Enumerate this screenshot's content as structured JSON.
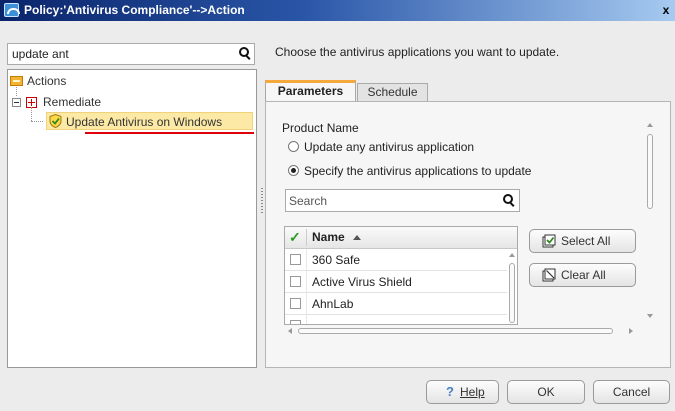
{
  "window": {
    "title": "Policy:'Antivirus Compliance'-->Action",
    "close_glyph": "x"
  },
  "left": {
    "search_value": "update ant",
    "tree": {
      "actions_label": "Actions",
      "remediate_label": "Remediate",
      "selected_item_label": "Update Antivirus on Windows"
    }
  },
  "right": {
    "instruction": "Choose the antivirus applications you want to update.",
    "tabs": [
      {
        "label": "Parameters",
        "active": true
      },
      {
        "label": "Schedule",
        "active": false
      }
    ],
    "product_name_label": "Product Name",
    "radio_options": [
      {
        "label": "Update any antivirus application",
        "selected": false
      },
      {
        "label": "Specify the antivirus applications to update",
        "selected": true
      }
    ],
    "search_placeholder": "Search",
    "list": {
      "header_check_glyph": "✓",
      "header_name": "Name",
      "sort": "ascending",
      "rows": [
        {
          "label": "360 Safe",
          "checked": false
        },
        {
          "label": "Active Virus Shield",
          "checked": false
        },
        {
          "label": "AhnLab",
          "checked": false
        }
      ]
    },
    "select_all_label": "Select All",
    "clear_all_label": "Clear All"
  },
  "footer": {
    "help_label": "Help",
    "ok_label": "OK",
    "cancel_label": "Cancel"
  },
  "colors": {
    "titlebar_start": "#0a246a",
    "titlebar_end": "#a6caf0",
    "tab_accent": "#f4a83d",
    "selected_bg": "#fde9a6",
    "annotation_underline": "#e0000a",
    "check_green": "#2e9a22"
  },
  "icons": {
    "title": "policy-window-icon",
    "search": "magnifier-icon",
    "actions": "actions-folder-icon",
    "remediate": "red-cross-icon",
    "update_antivirus": "shield-check-icon",
    "select_all": "checkbox-checked-icon",
    "clear_all": "checkbox-clear-icon",
    "help": "help-question-icon"
  }
}
